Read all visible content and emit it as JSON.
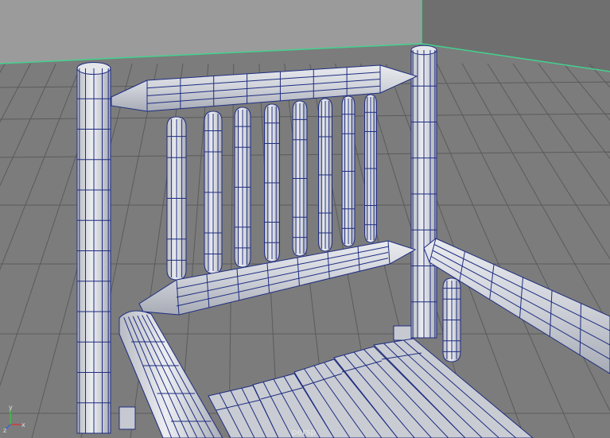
{
  "viewport": {
    "camera_label": "persp"
  },
  "axis_gizmo": {
    "x_label": "x",
    "y_label": "y",
    "z_label": "z"
  },
  "colors": {
    "room_back_wall": "#9b9b9b",
    "room_side_wall": "#707070",
    "room_floor": "#7d7d7d",
    "floor_grid": "#5a5a5a",
    "room_edge": "#44d18e",
    "mesh_fill": "#d4d6db",
    "mesh_wire": "#1f2d80"
  }
}
